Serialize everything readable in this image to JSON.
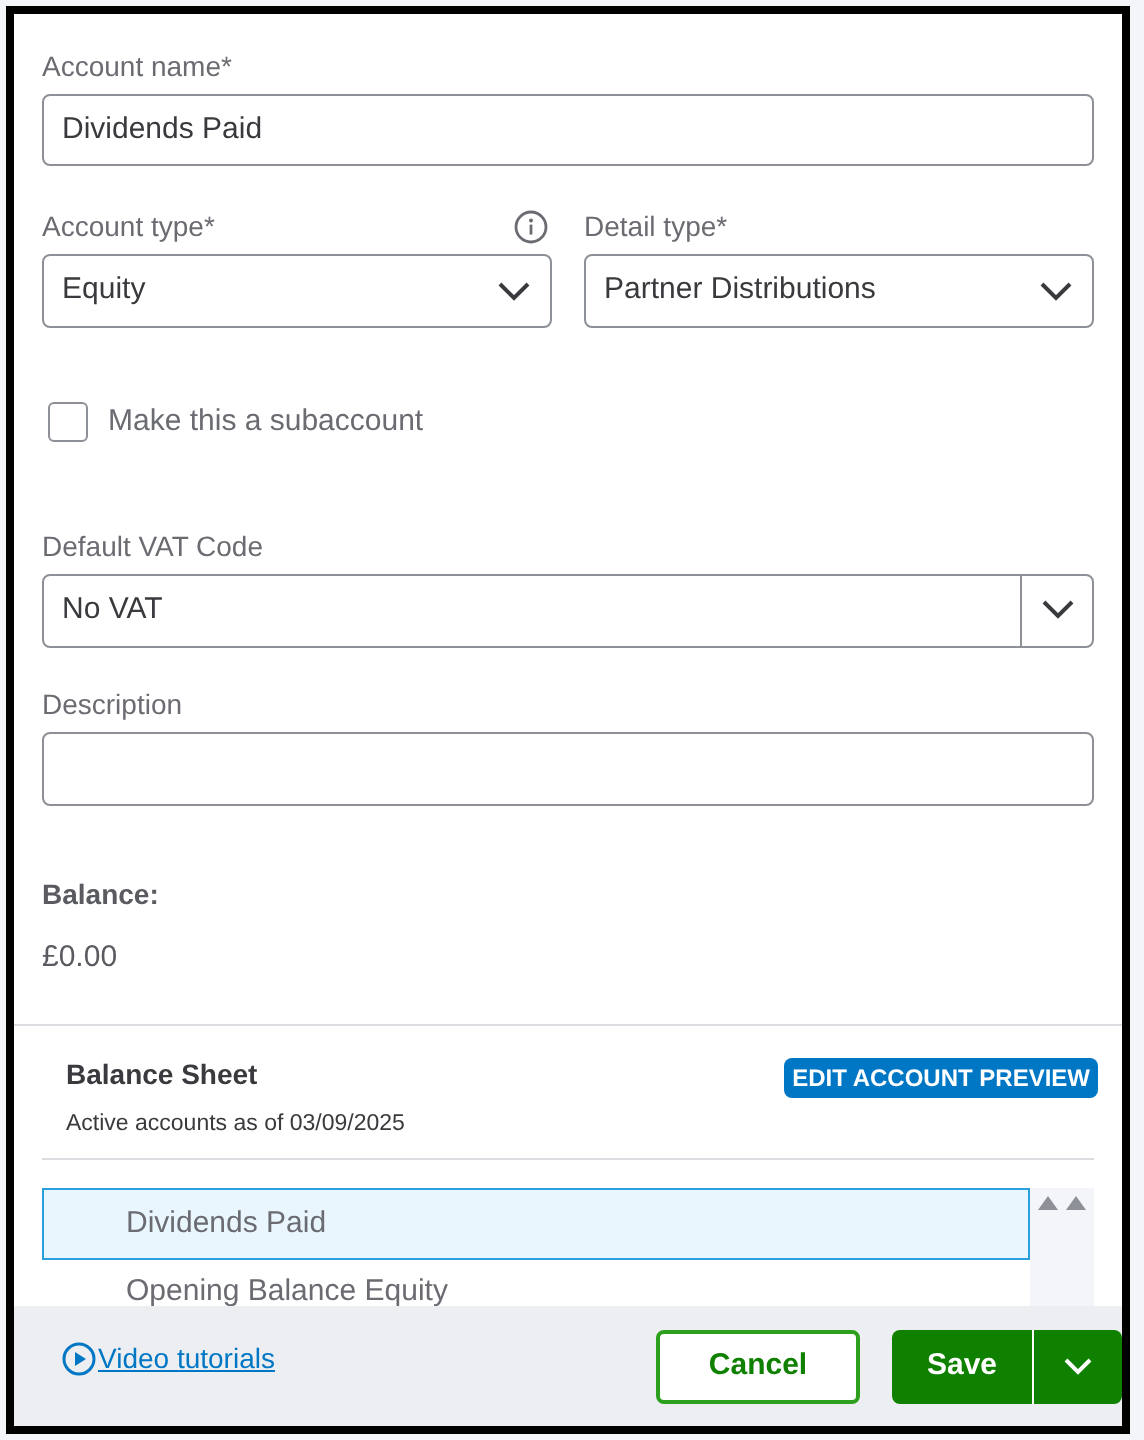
{
  "account_name": {
    "label": "Account name*",
    "value": "Dividends Paid"
  },
  "account_type": {
    "label": "Account type*",
    "value": "Equity"
  },
  "detail_type": {
    "label": "Detail type*",
    "value": "Partner Distributions"
  },
  "subaccount": {
    "label": "Make this a subaccount",
    "checked": false
  },
  "vat_code": {
    "label": "Default VAT Code",
    "value": "No VAT"
  },
  "description": {
    "label": "Description"
  },
  "balance": {
    "label": "Balance:",
    "value": "£0.00"
  },
  "preview": {
    "title": "Balance Sheet",
    "subtitle": "Active accounts as of 03/09/2025",
    "button": "EDIT ACCOUNT PREVIEW",
    "accounts": [
      {
        "name": "Dividends Paid",
        "selected": true
      },
      {
        "name": "Opening Balance Equity",
        "selected": false
      }
    ]
  },
  "footer": {
    "link": "Video tutorials",
    "cancel": "Cancel",
    "save": "Save"
  }
}
